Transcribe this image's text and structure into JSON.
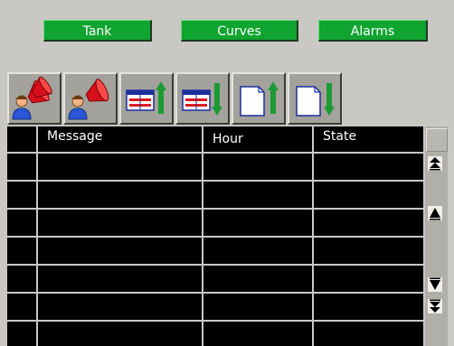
{
  "nav": {
    "tank_label": "Tank",
    "curves_label": "Curves",
    "alarms_label": "Alarms"
  },
  "toolbar": {
    "buttons": [
      {
        "icon": "acknowledge-horn-icon"
      },
      {
        "icon": "silence-horn-icon"
      },
      {
        "icon": "table-scroll-up-icon"
      },
      {
        "icon": "table-scroll-down-icon"
      },
      {
        "icon": "page-up-icon"
      },
      {
        "icon": "page-down-icon"
      }
    ]
  },
  "alarm_table": {
    "columns": [
      "",
      "Message",
      "Hour",
      "State"
    ],
    "rows": [
      [
        "",
        "",
        "",
        ""
      ],
      [
        "",
        "",
        "",
        ""
      ],
      [
        "",
        "",
        "",
        ""
      ],
      [
        "",
        "",
        "",
        ""
      ],
      [
        "",
        "",
        "",
        ""
      ],
      [
        "",
        "",
        "",
        ""
      ],
      [
        "",
        "",
        "",
        ""
      ]
    ]
  },
  "colors": {
    "background": "#c9c8c2",
    "nav_button": "#10a430",
    "table_background": "#000000",
    "grid_lines": "#c8c8c8"
  }
}
